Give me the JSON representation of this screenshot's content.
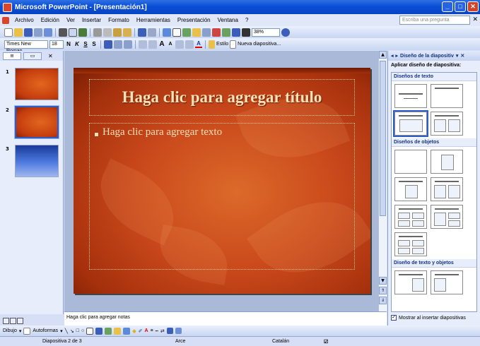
{
  "window": {
    "title": "Microsoft PowerPoint - [Presentación1]"
  },
  "menu": {
    "items": [
      "Archivo",
      "Edición",
      "Ver",
      "Insertar",
      "Formato",
      "Herramientas",
      "Presentación",
      "Ventana",
      "?"
    ],
    "help_placeholder": "Escriba una pregunta"
  },
  "toolbar": {
    "zoom": "38%",
    "font_name": "Times New Roman",
    "font_size": "18",
    "bold": "N",
    "italic": "K",
    "underline": "S",
    "shadow": "S",
    "design_label": "Estilo",
    "new_slide_label": "Nueva diapositiva..."
  },
  "slides_pane": {
    "numbers": [
      "1",
      "2",
      "3"
    ],
    "selected": 2
  },
  "slide": {
    "title": "Haga clic para agregar título",
    "body": "Haga clic para agregar texto"
  },
  "notes": {
    "placeholder": "Haga clic para agregar notas"
  },
  "taskpane": {
    "title": "Diseño de la diapositiv",
    "apply_label": "Aplicar diseño de diapositiva:",
    "sections": [
      "Diseños de texto",
      "Diseños de objetos",
      "Diseño de texto y objetos"
    ],
    "show_checkbox_label": "Mostrar al insertar diapositivas"
  },
  "drawbar": {
    "draw": "Dibujo",
    "autoshapes": "Autoformas"
  },
  "status": {
    "slide_pos": "Diapositiva 2 de 3",
    "design": "Arce",
    "language": "Catalán"
  },
  "colors": {
    "titlebar": "#0a4fd8",
    "slide_bg": "#c9481b",
    "slide_text": "#f5e2b8"
  }
}
